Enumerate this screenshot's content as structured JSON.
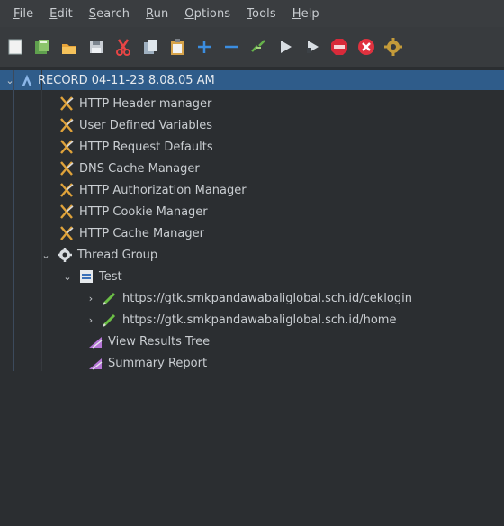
{
  "menu": [
    "File",
    "Edit",
    "Search",
    "Run",
    "Options",
    "Tools",
    "Help"
  ],
  "menu_mnemonic": [
    "F",
    "E",
    "S",
    "R",
    "O",
    "T",
    "H"
  ],
  "toolbar": {
    "buttons": [
      "new-icon",
      "templates-icon",
      "open-icon",
      "save-icon",
      "cut-icon",
      "copy-icon",
      "paste-icon",
      "expand-icon",
      "collapse-icon",
      "toggle-icon",
      "start-icon",
      "start-no-pause-icon",
      "stop-icon",
      "shutdown-icon",
      "settings-icon"
    ]
  },
  "tree": {
    "root": "RECORD 04-11-23 8.08.05 AM",
    "config_elements": [
      "HTTP Header manager",
      "User Defined Variables",
      "HTTP Request Defaults",
      "DNS Cache Manager",
      "HTTP Authorization Manager",
      "HTTP Cookie Manager",
      "HTTP Cache Manager"
    ],
    "thread_group": "Thread Group",
    "controller": "Test",
    "samplers": [
      "https://gtk.smkpandawabaliglobal.sch.id/ceklogin",
      "https://gtk.smkpandawabaliglobal.sch.id/home"
    ],
    "listeners": [
      "View Results Tree",
      "Summary Report"
    ]
  },
  "colors": {
    "selected_row": "#2f5c8a",
    "background": "#2b2e31",
    "menubar": "#3a3d40"
  }
}
